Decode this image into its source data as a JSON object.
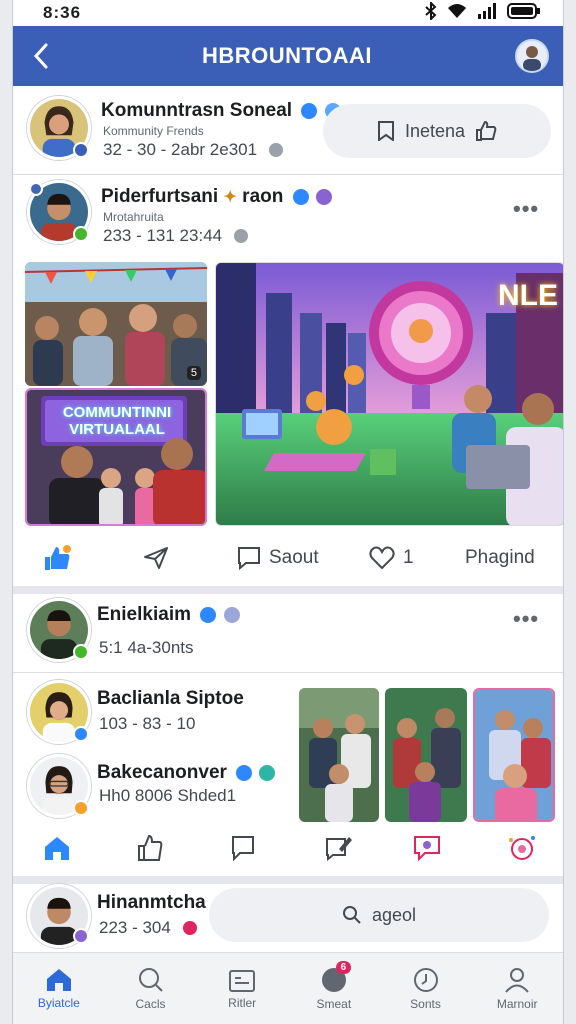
{
  "status": {
    "time": "8:36"
  },
  "header": {
    "title": "HBROUNTOAAI"
  },
  "post1": {
    "author": "Komunntrasn Soneal",
    "subline": "Kommunity Frends",
    "meta": "32 - 30 - 2abr 2e301",
    "pill_label": "Inetena"
  },
  "post2": {
    "author": "Piderfurtsani",
    "author_suffix": "raon",
    "subline": "Mrotahruita",
    "meta": "233 - 131 23:44",
    "banner_line1": "COMMUNTINNI",
    "banner_line2": "VIRTUALAAL",
    "mini_counter": "5",
    "neon_sign": "NLE",
    "actions": {
      "share_label": "",
      "comment_label": "Saout",
      "like_count": "1",
      "more_label": "Phagind"
    }
  },
  "post3": {
    "author": "Enielkiaim",
    "meta": "5:1 4a-30nts"
  },
  "post4": {
    "author": "Baclianla Siptoe",
    "meta": "103 - 83 - 10"
  },
  "post5": {
    "author": "Bakecanonver",
    "meta": "Hh0 8006 Shded1"
  },
  "post6": {
    "author": "Hinanmtcha",
    "meta": "223 - 304",
    "pill_label": "ageol"
  },
  "bottom_nav": [
    {
      "label": "Byiatcle",
      "icon": "home-icon",
      "active": true
    },
    {
      "label": "Cacls",
      "icon": "search-icon",
      "active": false
    },
    {
      "label": "Ritler",
      "icon": "calendar-icon",
      "active": false
    },
    {
      "label": "Smeat",
      "icon": "chat-icon",
      "active": false,
      "badge": "6"
    },
    {
      "label": "Sonts",
      "icon": "explore-icon",
      "active": false
    },
    {
      "label": "Marnoir",
      "icon": "profile-icon",
      "active": false
    }
  ],
  "colors": {
    "brand": "#3b5fb6",
    "accent": "#2d6ad8",
    "verified": "#2d88ff",
    "purple_badge": "#8a63d2"
  }
}
